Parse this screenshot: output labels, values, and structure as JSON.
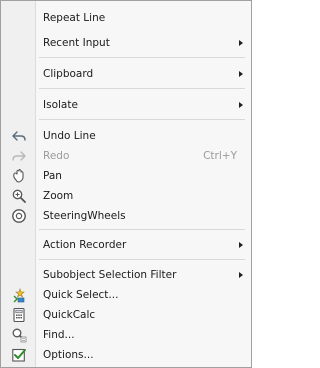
{
  "menu": {
    "items": {
      "repeat_line": {
        "label": "Repeat Line"
      },
      "recent_input": {
        "label": "Recent Input"
      },
      "clipboard": {
        "label": "Clipboard"
      },
      "isolate": {
        "label": "Isolate"
      },
      "undo_line": {
        "label": "Undo Line",
        "icon": "undo-icon"
      },
      "redo": {
        "label": "Redo",
        "shortcut": "Ctrl+Y",
        "icon": "redo-icon",
        "disabled": true
      },
      "pan": {
        "label": "Pan",
        "icon": "pan-icon"
      },
      "zoom": {
        "label": "Zoom",
        "icon": "zoom-icon"
      },
      "steering_wheels": {
        "label": "SteeringWheels",
        "icon": "steering-wheel-icon"
      },
      "action_recorder": {
        "label": "Action Recorder"
      },
      "subobject_selection_filter": {
        "label": "Subobject Selection Filter"
      },
      "quick_select": {
        "label": "Quick Select...",
        "icon": "quick-select-icon"
      },
      "quickcalc": {
        "label": "QuickCalc",
        "icon": "calculator-icon"
      },
      "find": {
        "label": "Find...",
        "icon": "find-icon"
      },
      "options": {
        "label": "Options...",
        "icon": "options-icon"
      }
    }
  },
  "colors": {
    "text": "#1b1b1b",
    "disabled_text": "#9a9a9a",
    "menu_bg": "#f7f7f7",
    "gutter_bg": "#f0f0f0"
  }
}
